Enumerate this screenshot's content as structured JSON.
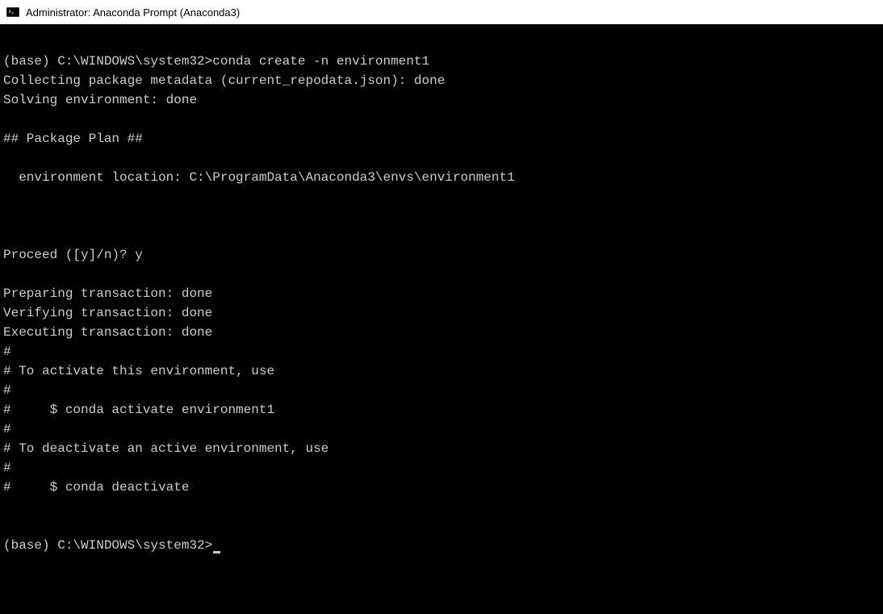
{
  "title_bar": {
    "icon_name": "terminal-icon",
    "text": "Administrator: Anaconda Prompt (Anaconda3)"
  },
  "terminal": {
    "lines": [
      "",
      "(base) C:\\WINDOWS\\system32>conda create -n environment1",
      "Collecting package metadata (current_repodata.json): done",
      "Solving environment: done",
      "",
      "## Package Plan ##",
      "",
      "  environment location: C:\\ProgramData\\Anaconda3\\envs\\environment1",
      "",
      "",
      "",
      "Proceed ([y]/n)? y",
      "",
      "Preparing transaction: done",
      "Verifying transaction: done",
      "Executing transaction: done",
      "#",
      "# To activate this environment, use",
      "#",
      "#     $ conda activate environment1",
      "#",
      "# To deactivate an active environment, use",
      "#",
      "#     $ conda deactivate",
      "",
      "",
      "(base) C:\\WINDOWS\\system32>"
    ]
  }
}
